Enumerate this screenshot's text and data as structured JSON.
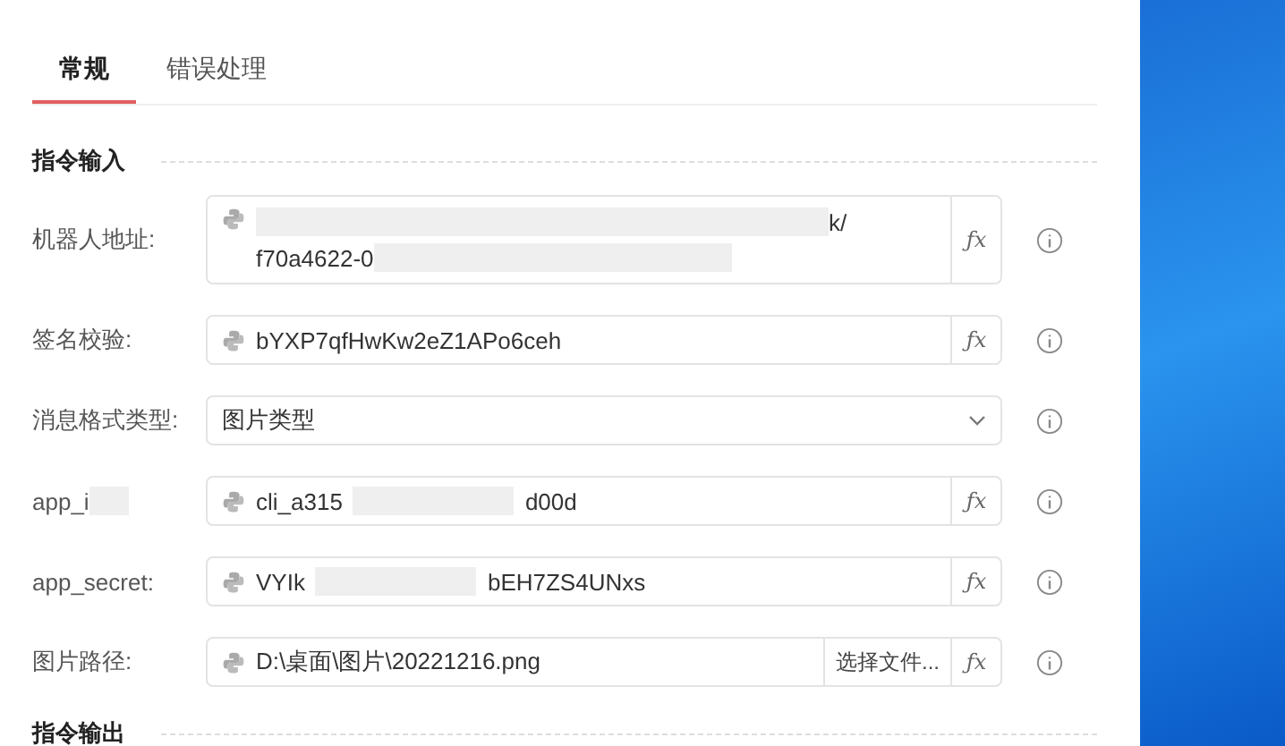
{
  "tabs": [
    {
      "label": "常规",
      "selected": true
    },
    {
      "label": "错误处理",
      "selected": false
    }
  ],
  "sections": [
    {
      "title": "指令输入",
      "fields": [
        {
          "label_parts": [
            {
              "kind": "text",
              "text": "机器人地址:"
            }
          ],
          "kind": "multiline",
          "lines": [
            [
              {
                "kind": "redacted"
              },
              {
                "kind": "text",
                "text": "k/"
              }
            ],
            [
              {
                "kind": "text",
                "text": "f70a4622-0"
              },
              {
                "kind": "redacted"
              }
            ]
          ],
          "python": true,
          "fx": "ƒx"
        },
        {
          "label_parts": [
            {
              "kind": "text",
              "text": "签名校验:"
            }
          ],
          "kind": "text",
          "value_parts": [
            {
              "kind": "text",
              "text": "bYXP7qfHwKw2eZ1APo6ceh"
            }
          ],
          "python": true,
          "fx": "ƒx"
        },
        {
          "label_parts": [
            {
              "kind": "text",
              "text": "消息格式类型:"
            }
          ],
          "kind": "select",
          "value_parts": [
            {
              "kind": "text",
              "text": "图片类型"
            }
          ]
        },
        {
          "label_parts": [
            {
              "kind": "text",
              "text": "app_i"
            },
            {
              "kind": "redacted"
            }
          ],
          "kind": "text",
          "value_parts": [
            {
              "kind": "text",
              "text": "cli_a315"
            },
            {
              "kind": "redacted"
            },
            {
              "kind": "text",
              "text": "d00d"
            }
          ],
          "python": true,
          "fx": "ƒx"
        },
        {
          "label_parts": [
            {
              "kind": "text",
              "text": "app_secret:"
            }
          ],
          "kind": "text",
          "value_parts": [
            {
              "kind": "text",
              "text": "VYIk"
            },
            {
              "kind": "redacted"
            },
            {
              "kind": "text",
              "text": "bEH7ZS4UNxs"
            }
          ],
          "python": true,
          "fx": "ƒx"
        },
        {
          "label_parts": [
            {
              "kind": "text",
              "text": "图片路径:"
            }
          ],
          "kind": "file",
          "value_parts": [
            {
              "kind": "text",
              "text": "D:\\桌面\\图片\\20221216.png"
            }
          ],
          "button": "选择文件...",
          "python": true,
          "fx": "ƒx"
        }
      ]
    },
    {
      "title": "指令输出"
    }
  ]
}
